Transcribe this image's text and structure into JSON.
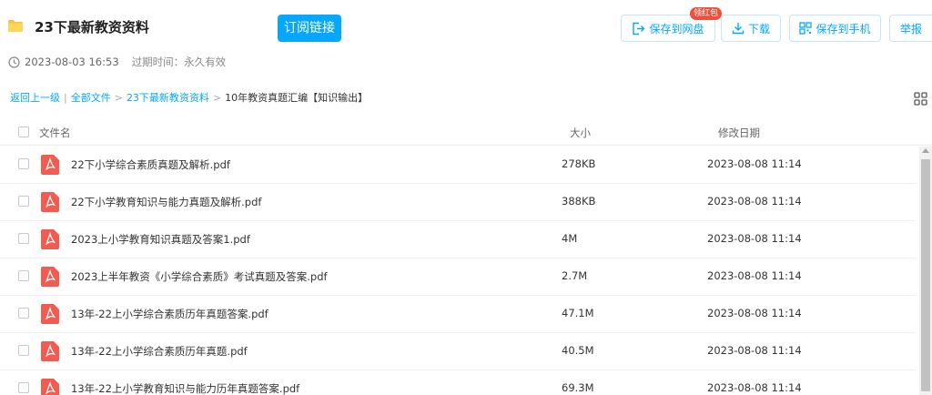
{
  "header": {
    "folder_icon": "folder-icon",
    "title": "23下最新教资资料",
    "subscribe_label": "订阅链接"
  },
  "actions": {
    "save_to_disk": "保存到网盘",
    "red_packet_badge": "领红包",
    "download": "下载",
    "save_to_phone": "保存到手机",
    "report": "举报"
  },
  "meta": {
    "clock_icon": "clock-icon",
    "share_time": "2023-08-03 16:53",
    "expire_text": "过期时间：永久有效"
  },
  "breadcrumb": {
    "back": "返回上一级",
    "sep1": "|",
    "all_files": "全部文件",
    "sep2": ">",
    "folder": "23下最新教资资料",
    "sep3": ">",
    "current": "10年教资真题汇编【知识输出】"
  },
  "columns": {
    "name": "文件名",
    "size": "大小",
    "date": "修改日期"
  },
  "files": [
    {
      "name": "22下小学综合素质真题及解析.pdf",
      "size": "278KB",
      "date": "2023-08-08 11:14"
    },
    {
      "name": "22下小学教育知识与能力真题及解析.pdf",
      "size": "388KB",
      "date": "2023-08-08 11:14"
    },
    {
      "name": "2023上小学教育知识真题及答案1.pdf",
      "size": "4M",
      "date": "2023-08-08 11:14"
    },
    {
      "name": "2023上半年教资《小学综合素质》考试真题及答案.pdf",
      "size": "2.7M",
      "date": "2023-08-08 11:14"
    },
    {
      "name": "13年-22上小学综合素质历年真题答案.pdf",
      "size": "47.1M",
      "date": "2023-08-08 11:14"
    },
    {
      "name": "13年-22上小学综合素质历年真题.pdf",
      "size": "40.5M",
      "date": "2023-08-08 11:14"
    },
    {
      "name": "13年-22上小学教育知识与能力历年真题答案.pdf",
      "size": "69.3M",
      "date": "2023-08-08 11:14"
    }
  ],
  "colors": {
    "accent": "#06a7ff",
    "pdf_red": "#f25b4f",
    "badge_red": "#f24e3c"
  }
}
